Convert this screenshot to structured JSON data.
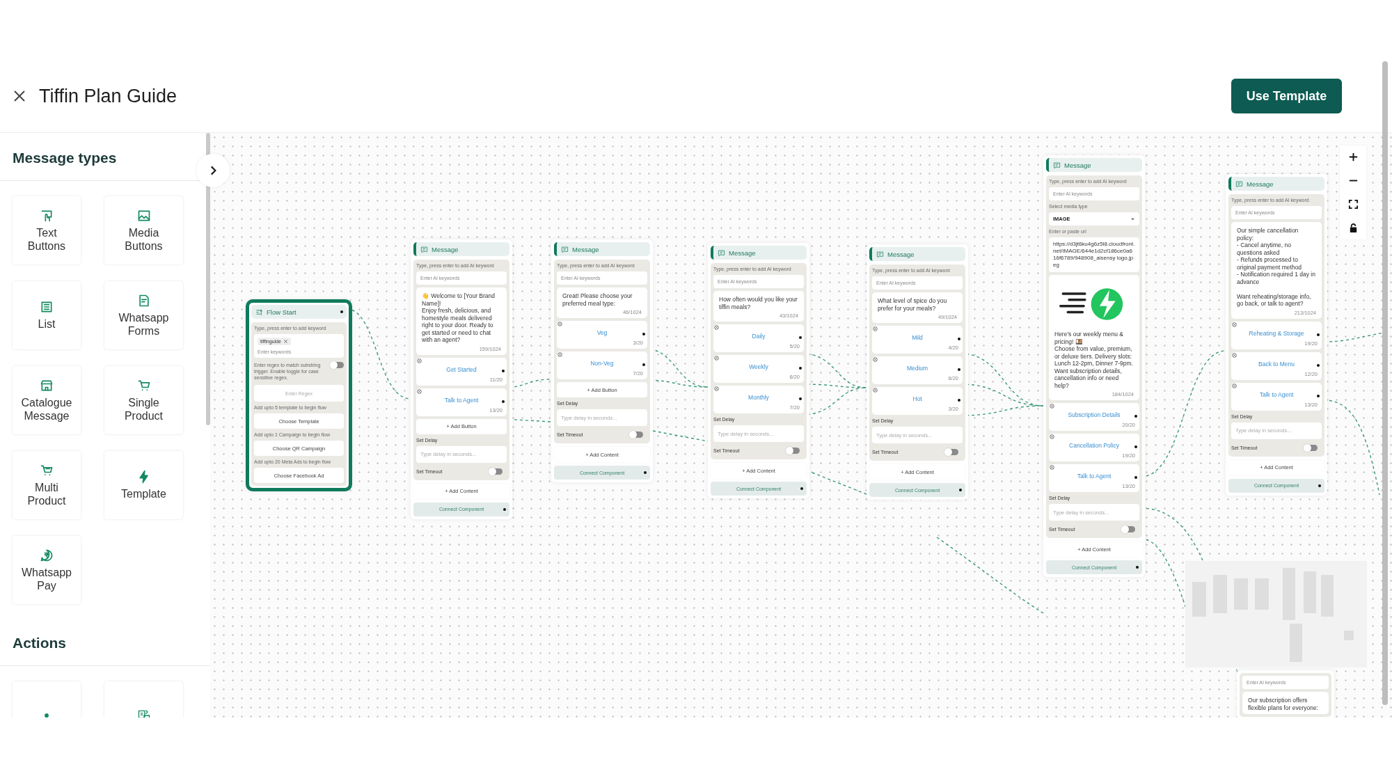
{
  "header": {
    "title": "Tiffin Plan Guide",
    "action": "Use Template"
  },
  "sidebar": {
    "sections": [
      {
        "title": "Message types",
        "items": [
          {
            "label": "Text Buttons"
          },
          {
            "label": "Media Buttons"
          },
          {
            "label": "List"
          },
          {
            "label": "Whatsapp Forms"
          },
          {
            "label": "Catalogue Message"
          },
          {
            "label": "Single Product"
          },
          {
            "label": "Multi Product"
          },
          {
            "label": "Template"
          },
          {
            "label": "Whatsapp Pay"
          }
        ]
      },
      {
        "title": "Actions"
      }
    ]
  },
  "nodes": [
    {
      "kind": "flow_start",
      "title": "Flow Start",
      "keyword_label": "Type, press enter to add keyword",
      "keywords": [
        "tiffinguide"
      ],
      "keyword_placeholder": "Enter keywords",
      "regex_note": "Enter regex to match substring trigger. Enable toggle for case sensitive regex.",
      "regex_toggle_on": false,
      "regex_placeholder": "Enter Regex",
      "pickers": [
        {
          "label": "Add upto 5 template to begin flow",
          "button": "Choose Template"
        },
        {
          "label": "Add upto 1 Campaign to begin flow",
          "button": "Choose QR Campaign"
        },
        {
          "label": "Add upto 20 Meta Ads to begin flow",
          "button": "Choose Facebook Ad"
        }
      ]
    },
    {
      "kind": "message",
      "title": "Message",
      "keyword_label": "Type, press enter to add AI keyword",
      "keyword_placeholder": "Enter AI keywords",
      "text": "👋 Welcome to [Your Brand Name]!\nEnjoy fresh, delicious, and homestyle meals delivered right to your door. Ready to get started or need to chat with an agent?",
      "counter": "159/1024",
      "buttons": [
        {
          "label": "Get Started",
          "counter": "11/20"
        },
        {
          "label": "Talk to Agent",
          "counter": "13/20"
        }
      ],
      "add_button": "+ Add Button",
      "delay_label": "Set Delay",
      "delay_placeholder": "Type delay in seconds...",
      "timeout_label": "Set Timeout",
      "timeout_on": false,
      "add_content": "+ Add Content",
      "connect": "Connect Component"
    },
    {
      "kind": "message",
      "title": "Message",
      "keyword_label": "Type, press enter to add AI keyword",
      "keyword_placeholder": "Enter AI keywords",
      "text": "Great! Please choose your preferred meal type:",
      "counter": "46/1024",
      "buttons": [
        {
          "label": "Veg",
          "counter": "3/20"
        },
        {
          "label": "Non-Veg",
          "counter": "7/20"
        }
      ],
      "add_button": "+ Add Button",
      "delay_label": "Set Delay",
      "delay_placeholder": "Type delay in seconds...",
      "timeout_label": "Set Timeout",
      "timeout_on": false,
      "add_content": "+ Add Content",
      "connect": "Connect Component"
    },
    {
      "kind": "message",
      "title": "Message",
      "keyword_label": "Type, press enter to add AI keyword",
      "keyword_placeholder": "Enter AI keywords",
      "text": "How often would you like your tiffin meals?",
      "counter": "43/1024",
      "buttons": [
        {
          "label": "Daily",
          "counter": "5/20"
        },
        {
          "label": "Weekly",
          "counter": "6/20"
        },
        {
          "label": "Monthly",
          "counter": "7/20"
        }
      ],
      "delay_label": "Set Delay",
      "delay_placeholder": "Type delay in seconds...",
      "timeout_label": "Set Timeout",
      "timeout_on": false,
      "add_content": "+ Add Content",
      "connect": "Connect Component"
    },
    {
      "kind": "message",
      "title": "Message",
      "keyword_label": "Type, press enter to add AI keyword",
      "keyword_placeholder": "Enter AI keywords",
      "text": "What level of spice do you prefer for your meals?",
      "counter": "49/1024",
      "buttons": [
        {
          "label": "Mild",
          "counter": "4/20"
        },
        {
          "label": "Medium",
          "counter": "6/20"
        },
        {
          "label": "Hot",
          "counter": "3/20"
        }
      ],
      "delay_label": "Set Delay",
      "delay_placeholder": "Type delay in seconds...",
      "timeout_label": "Set Timeout",
      "timeout_on": false,
      "add_content": "+ Add Content",
      "connect": "Connect Component"
    },
    {
      "kind": "message",
      "title": "Message",
      "keyword_label": "Type, press enter to add AI keyword",
      "keyword_placeholder": "Enter AI keywords",
      "media": {
        "type_label": "Select media type",
        "type_value": "IMAGE",
        "url_label": "Enter or paste url",
        "url": "https://d3jt6ku4g6z5l8.cloudfront.net/IMAGE/644e1d2cf186ce0a616f6789/948908_aisensy logo.jpeg"
      },
      "text": "Here's our weekly menu & pricing! 🍱\nChoose from value, premium, or deluxe tiers. Delivery slots: Lunch 12-2pm, Dinner 7-9pm. Want subscription details, cancellation info or need help?",
      "counter": "184/1024",
      "buttons": [
        {
          "label": "Subscription Details",
          "counter": "20/20"
        },
        {
          "label": "Cancellation Policy",
          "counter": "19/20"
        },
        {
          "label": "Talk to Agent",
          "counter": "13/20"
        }
      ],
      "delay_label": "Set Delay",
      "delay_placeholder": "Type delay in seconds...",
      "timeout_label": "Set Timeout",
      "timeout_on": false,
      "add_content": "+ Add Content",
      "connect": "Connect Component"
    },
    {
      "kind": "message",
      "title": "Message",
      "keyword_label": "Type, press enter to add AI keyword",
      "keyword_placeholder": "Enter AI keywords",
      "text": "Our simple cancellation policy:\n- Cancel anytime, no questions asked\n- Refunds processed to original payment method\n- Notification required 1 day in advance\n\nWant reheating/storage info, go back, or talk to agent?",
      "counter": "213/1024",
      "buttons": [
        {
          "label": "Reheating & Storage",
          "counter": "19/20"
        },
        {
          "label": "Back to Menu",
          "counter": "12/20"
        },
        {
          "label": "Talk to Agent",
          "counter": "13/20"
        }
      ],
      "delay_label": "Set Delay",
      "delay_placeholder": "Type delay in seconds...",
      "timeout_label": "Set Timeout",
      "timeout_on": false,
      "add_content": "+ Add Content",
      "connect": "Connect Component"
    },
    {
      "kind": "message",
      "keyword_placeholder": "Enter AI keywords",
      "text": "Our subscription offers flexible plans for everyone:"
    }
  ]
}
